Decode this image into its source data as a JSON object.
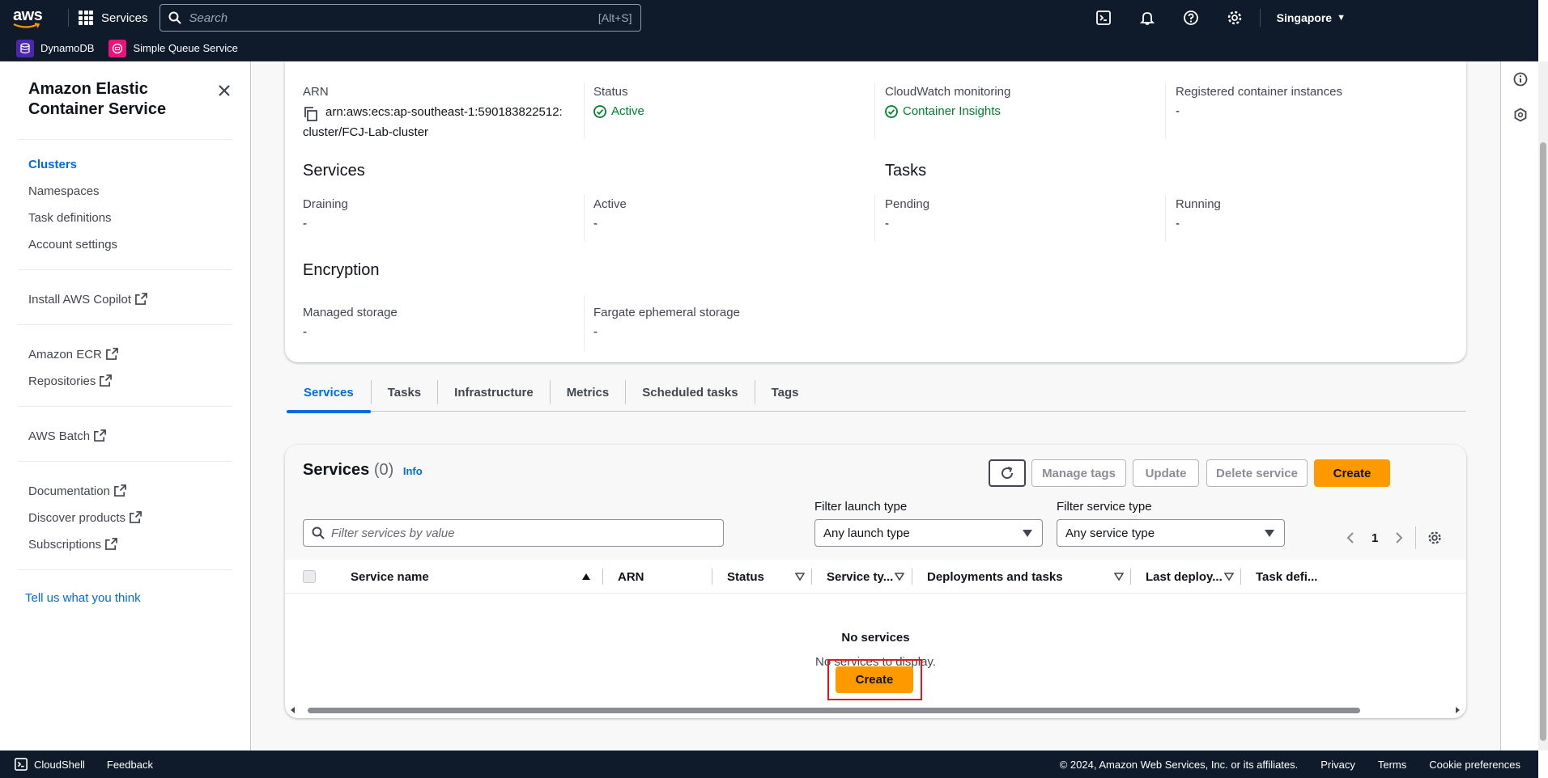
{
  "topnav": {
    "logo": "aws",
    "services_label": "Services",
    "search_placeholder": "Search",
    "search_shortcut": "[Alt+S]",
    "region": "Singapore",
    "icons": [
      "cloudshell-icon",
      "notifications-bell-icon",
      "help-icon",
      "settings-gear-icon"
    ]
  },
  "favorites": [
    {
      "label": "DynamoDB",
      "icon": "dynamodb-icon",
      "color": "#4d27aa"
    },
    {
      "label": "Simple Queue Service",
      "icon": "sqs-icon",
      "color": "#e7157b"
    }
  ],
  "sidenav": {
    "title": "Amazon Elastic Container Service",
    "items": [
      {
        "label": "Clusters"
      },
      {
        "label": "Namespaces"
      },
      {
        "label": "Task definitions"
      },
      {
        "label": "Account settings"
      }
    ],
    "copilot": "Install AWS Copilot",
    "ecr": "Amazon ECR",
    "repositories": "Repositories",
    "batch": "AWS Batch",
    "documentation": "Documentation",
    "discover": "Discover products",
    "subscriptions": "Subscriptions",
    "feedback": "Tell us what you think"
  },
  "overview": {
    "arn_label": "ARN",
    "arn_line1": "arn:aws:ecs:ap-southeast-1:590183822512:",
    "arn_line2": "cluster/FCJ-Lab-cluster",
    "status_label": "Status",
    "status_value": "Active",
    "cloudwatch_label": "CloudWatch monitoring",
    "cloudwatch_value": "Container Insights",
    "registered_label": "Registered container instances",
    "registered_value": "-",
    "services_title": "Services",
    "draining_label": "Draining",
    "draining_value": "-",
    "active_label": "Active",
    "active_value": "-",
    "tasks_title": "Tasks",
    "pending_label": "Pending",
    "pending_value": "-",
    "running_label": "Running",
    "running_value": "-",
    "encryption_title": "Encryption",
    "managed_label": "Managed storage",
    "managed_value": "-",
    "fargate_label": "Fargate ephemeral storage",
    "fargate_value": "-"
  },
  "tabs": [
    {
      "label": "Services"
    },
    {
      "label": "Tasks"
    },
    {
      "label": "Infrastructure"
    },
    {
      "label": "Metrics"
    },
    {
      "label": "Scheduled tasks"
    },
    {
      "label": "Tags"
    }
  ],
  "services_panel": {
    "title": "Services",
    "count": "(0)",
    "info": "Info",
    "manage_tags": "Manage tags",
    "update": "Update",
    "delete": "Delete service",
    "create": "Create",
    "filter_placeholder": "Filter services by value",
    "launch_label": "Filter launch type",
    "launch_value": "Any launch type",
    "service_type_label": "Filter service type",
    "service_type_value": "Any service type",
    "page": "1",
    "columns": [
      "Service name",
      "ARN",
      "Status",
      "Service ty...",
      "Deployments and tasks",
      "Last deploy...",
      "Task defi..."
    ],
    "empty_title": "No services",
    "empty_sub": "No services to display.",
    "empty_create": "Create"
  },
  "footer": {
    "cloudshell": "CloudShell",
    "feedback": "Feedback",
    "copyright": "© 2024, Amazon Web Services, Inc. or its affiliates.",
    "privacy": "Privacy",
    "terms": "Terms",
    "cookies": "Cookie preferences"
  },
  "colors": {
    "nav_bg": "#0f1b2a",
    "link_blue": "#006ce0",
    "primary_orange": "#ff9900",
    "success_green": "#00802f",
    "highlight_red": "#e0191e"
  }
}
